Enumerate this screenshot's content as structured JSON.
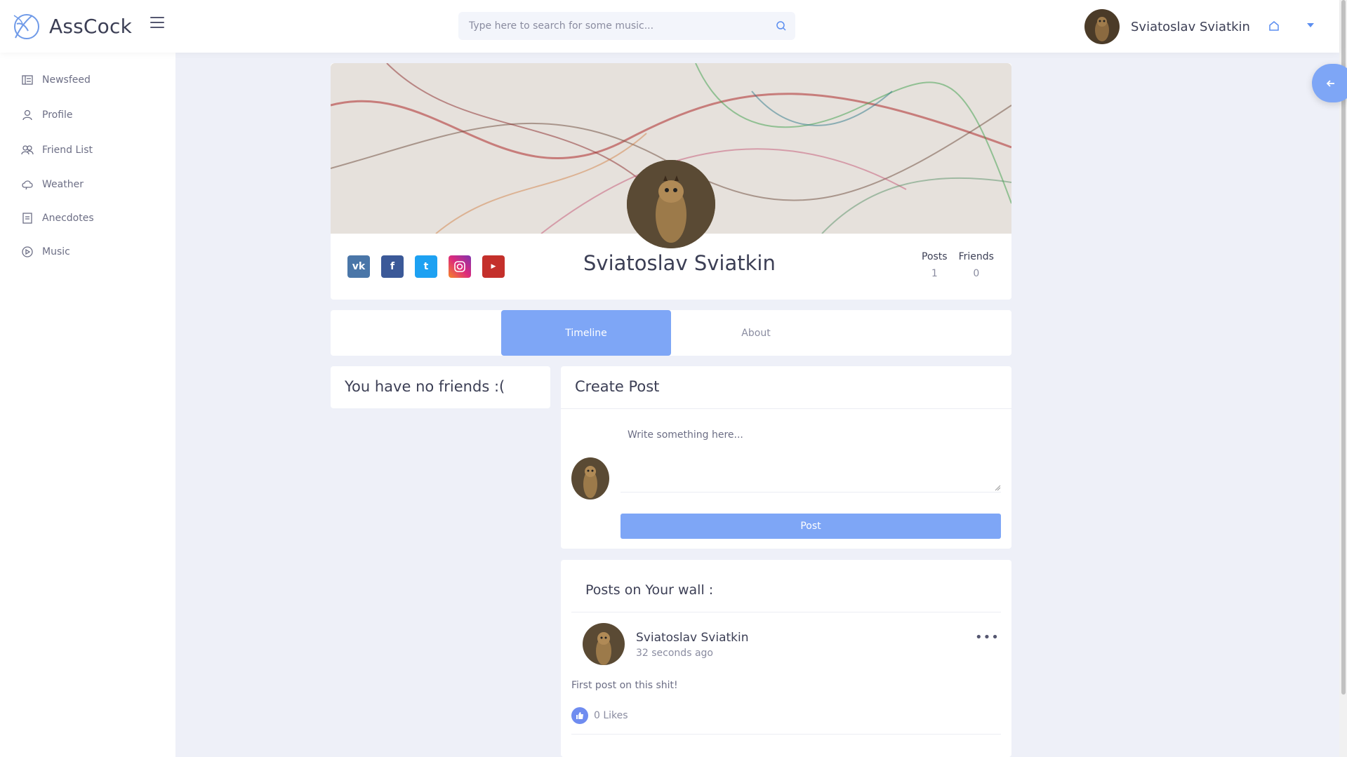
{
  "app": {
    "name": "AssCock",
    "accent_color": "#7ea6f6"
  },
  "header": {
    "search_placeholder": "Type here to search for some music...",
    "user_name": "Sviatoslav Sviatkin"
  },
  "sidebar": {
    "items": [
      {
        "label": "Newsfeed",
        "icon": "newsfeed-icon"
      },
      {
        "label": "Profile",
        "icon": "user-icon"
      },
      {
        "label": "Friend List",
        "icon": "friends-icon"
      },
      {
        "label": "Weather",
        "icon": "cloud-icon"
      },
      {
        "label": "Anecdotes",
        "icon": "document-icon"
      },
      {
        "label": "Music",
        "icon": "play-icon"
      }
    ]
  },
  "profile": {
    "name": "Sviatoslav Sviatkin",
    "social": [
      "vk-icon",
      "facebook-icon",
      "twitter-icon",
      "instagram-icon",
      "youtube-icon"
    ],
    "stats": [
      {
        "label": "Posts",
        "value": "1"
      },
      {
        "label": "Friends",
        "value": "0"
      }
    ]
  },
  "tabs": {
    "timeline": "Timeline",
    "about": "About"
  },
  "friends": {
    "empty_text": "You have no friends :("
  },
  "create_post": {
    "title": "Create Post",
    "placeholder": "Write something here...",
    "button": "Post"
  },
  "wall": {
    "title": "Posts on Your wall :",
    "posts": [
      {
        "author": "Sviatoslav Sviatkin",
        "time": "32 seconds ago",
        "text": "First post on this shit!",
        "likes": "0 Likes"
      }
    ]
  }
}
